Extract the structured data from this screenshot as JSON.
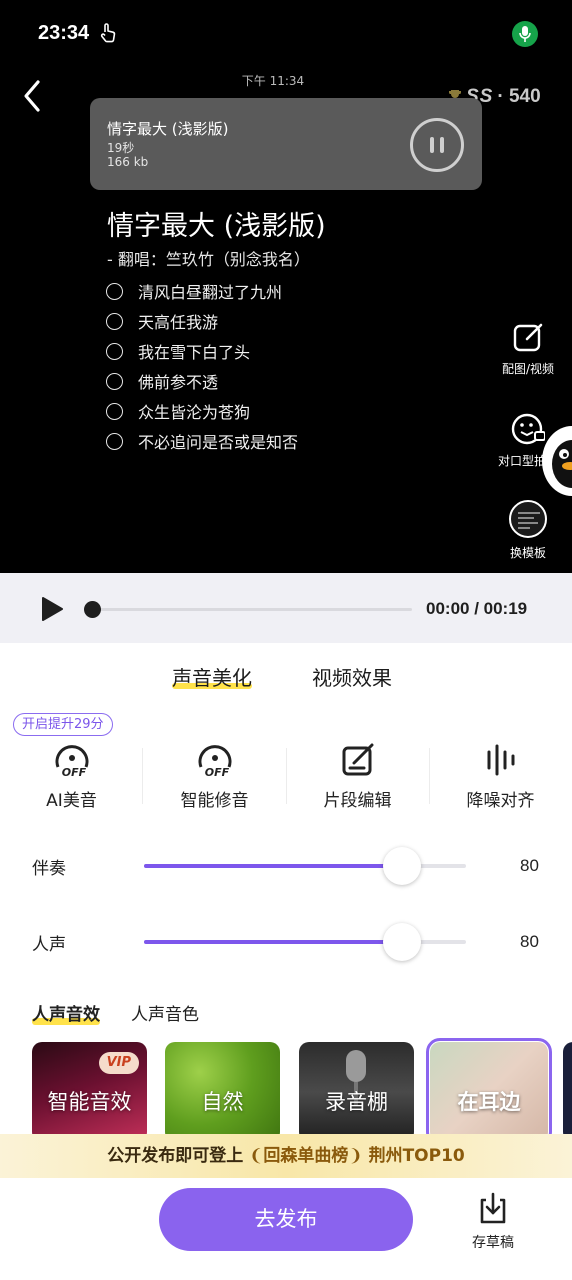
{
  "status_bar": {
    "time": "23:34"
  },
  "chat": {
    "timestamp": "下午 11:34"
  },
  "badge": {
    "ss": "SS",
    "count": "· 540"
  },
  "audio_card": {
    "title": "情字最大 (浅影版)",
    "duration": "19秒",
    "size": "166 kb"
  },
  "lyrics": {
    "title": "情字最大 (浅影版)",
    "subtitle": "-  翻唱：竺玖竹（别念我名）",
    "lines": [
      "清风白昼翻过了九州",
      "天高任我游",
      "我在雪下白了头",
      "佛前参不透",
      "众生皆沦为苍狗",
      "不必追问是否或是知否"
    ]
  },
  "side_tools": {
    "edit_label": "配图/视频",
    "lipsync_label": "对口型拍摄",
    "template_label": "换模板"
  },
  "player": {
    "time": "00:00 / 00:19",
    "progress": 0
  },
  "tabs": {
    "sound": "声音美化",
    "video": "视频效果"
  },
  "promo": "开启提升29分",
  "tools": [
    {
      "label": "AI美音"
    },
    {
      "label": "智能修音"
    },
    {
      "label": "片段编辑"
    },
    {
      "label": "降噪对齐"
    }
  ],
  "sliders": [
    {
      "label": "伴奏",
      "value": 80,
      "display": "80"
    },
    {
      "label": "人声",
      "value": 80,
      "display": "80"
    }
  ],
  "fx_tabs": {
    "effect": "人声音效",
    "tone": "人声音色"
  },
  "fx_cards": [
    {
      "name": "智能音效",
      "vip": "VIP"
    },
    {
      "name": "自然"
    },
    {
      "name": "录音棚"
    },
    {
      "name": "在耳边"
    }
  ],
  "banner": {
    "prefix": "公开发布即可登上",
    "highlight": "回森单曲榜",
    "suffix": "荆州TOP10"
  },
  "actions": {
    "publish": "去发布",
    "draft": "存草稿"
  },
  "colors": {
    "accent": "#8a63ee",
    "highlight": "#ffe24a"
  }
}
